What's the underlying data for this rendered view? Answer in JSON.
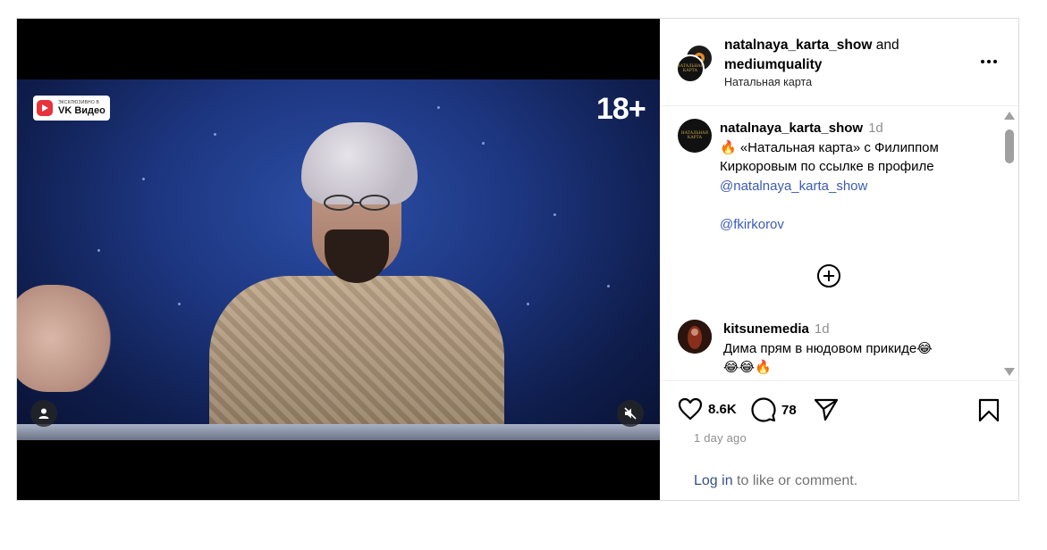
{
  "video": {
    "badge_small": "ЭКСКЛЮЗИВНО В",
    "badge_big": "VK Видео",
    "age_rating": "18+",
    "avatar_overlay_text": "НАТАЛЬНАЯ КАРТА"
  },
  "header": {
    "user1": "natalnaya_karta_show",
    "and_text": " and ",
    "user2": "mediumquality",
    "subtitle": "Натальная карта"
  },
  "comments": [
    {
      "username": "natalnaya_karta_show",
      "time": "1d",
      "text_line1": "🔥 «Натальная карта» с Филиппом",
      "text_line2": "Киркоровым по ссылке в профиле",
      "mention1": "@natalnaya_karta_show",
      "mention2": "@fkirkorov"
    },
    {
      "username": "kitsunemedia",
      "time": "1d",
      "text_line1": "Дима прям в нюдовом прикиде😂",
      "text_line2": "😂😂🔥"
    }
  ],
  "actions": {
    "likes": "8.6K",
    "comments": "78"
  },
  "posted": "1 day ago",
  "login": {
    "link": "Log in",
    "rest": " to like or comment."
  },
  "colors": {
    "link": "#3b5bb5",
    "muted": "#8e8e8e",
    "border": "#dbdbdb",
    "vk_red": "#e8323c"
  }
}
